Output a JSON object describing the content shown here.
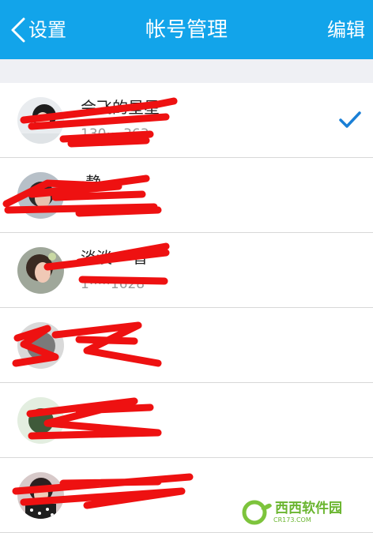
{
  "nav": {
    "back_label": "设置",
    "title": "帐号管理",
    "edit_label": "编辑"
  },
  "accounts": [
    {
      "name": "会飞的星星",
      "number": "130····363",
      "selected": true
    },
    {
      "name": "·静",
      "number": "",
      "selected": false
    },
    {
      "name": "淡淡····香",
      "number": "1·····1628",
      "selected": false
    },
    {
      "name": "",
      "number": "",
      "selected": false
    },
    {
      "name": "",
      "number": "",
      "selected": false
    },
    {
      "name": "",
      "number": "",
      "selected": false
    }
  ],
  "colors": {
    "nav_bg": "#12a4ea",
    "check": "#1a7fd6",
    "redaction": "#ee1111"
  },
  "watermark": {
    "text": "西西软件园",
    "sub": "CR173.COM"
  }
}
